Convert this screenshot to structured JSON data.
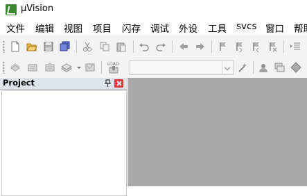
{
  "window": {
    "title": "µVision"
  },
  "menu": {
    "items": [
      {
        "label": "文件"
      },
      {
        "label": "编辑"
      },
      {
        "label": "视图"
      },
      {
        "label": "项目"
      },
      {
        "label": "闪存"
      },
      {
        "label": "调试"
      },
      {
        "label": "外设"
      },
      {
        "label": "工具"
      },
      {
        "label": "svcs"
      },
      {
        "label": "窗口"
      },
      {
        "label": "帮助"
      }
    ]
  },
  "toolbar1": {
    "icons": [
      "new-file-icon",
      "open-file-icon",
      "save-icon",
      "save-all-icon",
      "cut-icon",
      "copy-icon",
      "paste-icon",
      "undo-icon",
      "redo-icon",
      "navigate-back-icon",
      "navigate-forward-icon",
      "bookmark-icon",
      "prev-bookmark-icon",
      "next-bookmark-icon",
      "clear-bookmarks-icon",
      "indent-icon"
    ]
  },
  "toolbar2": {
    "icons": [
      "translate-icon",
      "build-icon",
      "rebuild-icon",
      "batch-build-icon",
      "dropdown-arrow-icon",
      "stop-build-icon",
      "download-icon",
      "target-options-icon",
      "manage-components-icon",
      "file-extensions-icon",
      "select-packs-icon"
    ],
    "load_label": "LOAD",
    "target_select": {
      "value": ""
    }
  },
  "project_panel": {
    "title": "Project"
  },
  "colors": {
    "editor_bg": "#a9a9a9",
    "panel_header": "#dfe3ea",
    "close_red": "#d93a3a",
    "logo_green": "#3b8a2f"
  }
}
